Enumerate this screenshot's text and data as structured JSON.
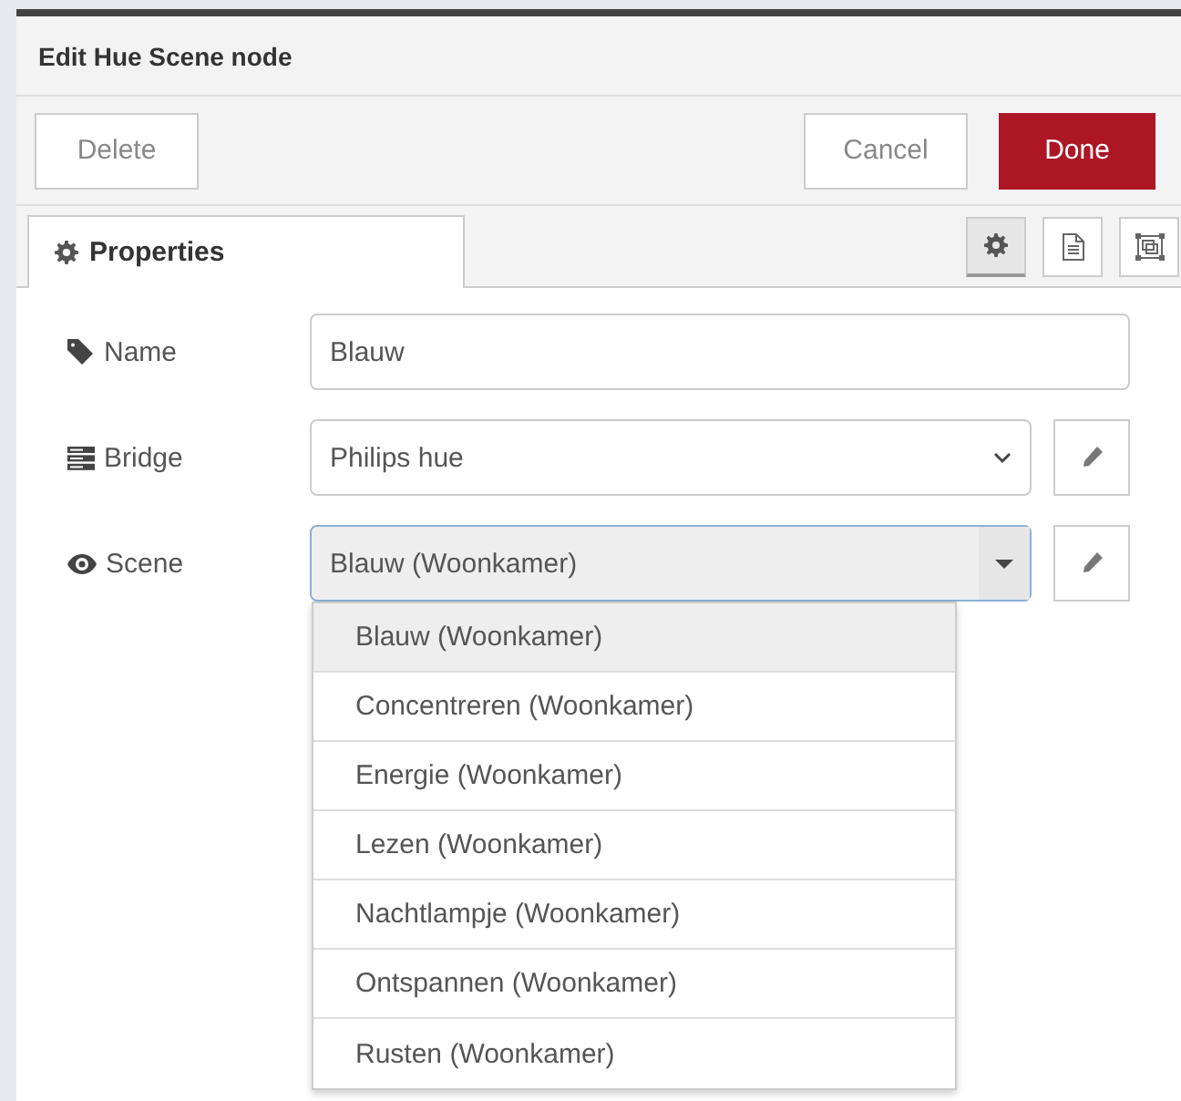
{
  "dialog": {
    "title": "Edit Hue Scene node"
  },
  "toolbar": {
    "left_buttons": [
      {
        "label": "Delete",
        "kind": "default"
      }
    ],
    "right_buttons": [
      {
        "label": "Cancel",
        "kind": "default"
      },
      {
        "label": "Done",
        "kind": "primary"
      }
    ]
  },
  "tabs": [
    {
      "label": "Properties",
      "selected": true
    }
  ],
  "tab_icons": [
    {
      "kind": "settings",
      "selected": true
    },
    {
      "kind": "description",
      "selected": false
    },
    {
      "kind": "appearance",
      "selected": false
    }
  ],
  "fields": [
    {
      "label": "Name",
      "kind": "text",
      "value": "Blauw"
    },
    {
      "label": "Bridge",
      "kind": "select",
      "value": "Philips hue",
      "edit_button": true
    },
    {
      "label": "Scene",
      "kind": "combo",
      "value": "Blauw (Woonkamer)",
      "edit_button": true
    }
  ],
  "dropdown": {
    "options": [
      {
        "label": "Blauw (Woonkamer)",
        "selected": true
      },
      {
        "label": "Concentreren (Woonkamer)",
        "selected": false
      },
      {
        "label": "Energie (Woonkamer)",
        "selected": false
      },
      {
        "label": "Lezen (Woonkamer)",
        "selected": false
      },
      {
        "label": "Nachtlampje (Woonkamer)",
        "selected": false
      },
      {
        "label": "Ontspannen (Woonkamer)",
        "selected": false
      },
      {
        "label": "Rusten (Woonkamer)",
        "selected": false
      }
    ]
  }
}
